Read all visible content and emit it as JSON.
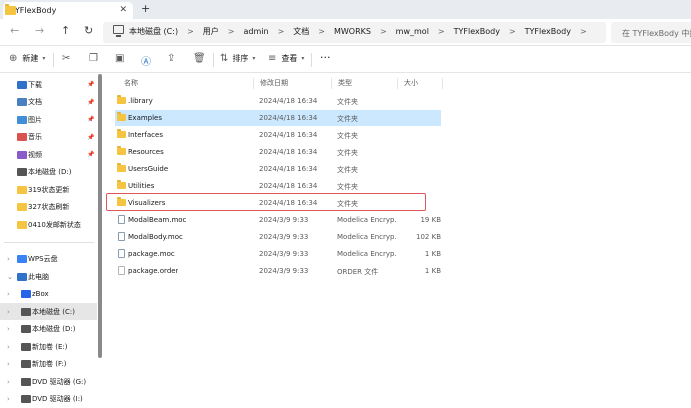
{
  "window": {
    "tab_title": "TYFlexBody",
    "tab_close": "✕",
    "tab_add": "+"
  },
  "nav": {
    "back": "←",
    "forward": "→",
    "up": "↑",
    "refresh": "↻"
  },
  "address": {
    "crumbs": [
      "本地磁盘 (C:)",
      "用户",
      "admin",
      "文档",
      "MWORKS",
      "mw_mol",
      "TYFlexBody",
      "TYFlexBody"
    ],
    "separator": ">",
    "search_placeholder": "在 TYFlexBody 中搜索"
  },
  "toolbar": {
    "new_label": "新建",
    "sort_label": "排序",
    "view_label": "查看",
    "more_label": "···"
  },
  "sidebar": {
    "pinned": [
      {
        "label": "下载",
        "icon": "download-icon",
        "color": "#2f72c9"
      },
      {
        "label": "文档",
        "icon": "document-icon",
        "color": "#4a7fc1"
      },
      {
        "label": "图片",
        "icon": "picture-icon",
        "color": "#3f8fd6"
      },
      {
        "label": "音乐",
        "icon": "music-icon",
        "color": "#d9534f"
      },
      {
        "label": "视频",
        "icon": "video-icon",
        "color": "#8a5cc7"
      },
      {
        "label": "本地磁盘 (D:)",
        "icon": "drive-icon",
        "color": "#555555"
      },
      {
        "label": "319状态更新",
        "icon": "folder-icon",
        "color": "#f5c542"
      },
      {
        "label": "327状态刷新",
        "icon": "folder-icon",
        "color": "#f5c542"
      },
      {
        "label": "0410发邮新状态",
        "icon": "folder-icon",
        "color": "#f5c542"
      }
    ],
    "tree": [
      {
        "label": "WPS云盘",
        "icon": "cloud-icon",
        "color": "#3b82f6"
      },
      {
        "label": "此电脑",
        "icon": "pc-icon",
        "color": "#2f72c9"
      },
      {
        "label": "zBox",
        "icon": "zbox-icon",
        "color": "#2563eb"
      },
      {
        "label": "本地磁盘 (C:)",
        "icon": "drive-icon",
        "color": "#555555"
      },
      {
        "label": "本地磁盘 (D:)",
        "icon": "drive-icon",
        "color": "#555555"
      },
      {
        "label": "新加卷 (E:)",
        "icon": "drive-icon",
        "color": "#555555"
      },
      {
        "label": "新加卷 (F:)",
        "icon": "drive-icon",
        "color": "#555555"
      },
      {
        "label": "DVD 驱动器 (G:)",
        "icon": "dvd-icon",
        "color": "#555555"
      },
      {
        "label": "DVD 驱动器 (I:)",
        "icon": "dvd-icon",
        "color": "#555555"
      }
    ]
  },
  "columns": {
    "name": "名称",
    "date": "修改日期",
    "type": "类型",
    "size": "大小"
  },
  "files": [
    {
      "name": ".library",
      "date": "2024/4/18 16:34",
      "type": "文件夹",
      "size": "",
      "kind": "folder"
    },
    {
      "name": "Examples",
      "date": "2024/4/18 16:34",
      "type": "文件夹",
      "size": "",
      "kind": "folder"
    },
    {
      "name": "Interfaces",
      "date": "2024/4/18 16:34",
      "type": "文件夹",
      "size": "",
      "kind": "folder"
    },
    {
      "name": "Resources",
      "date": "2024/4/18 16:34",
      "type": "文件夹",
      "size": "",
      "kind": "folder"
    },
    {
      "name": "UsersGuide",
      "date": "2024/4/18 16:34",
      "type": "文件夹",
      "size": "",
      "kind": "folder"
    },
    {
      "name": "Utilities",
      "date": "2024/4/18 16:34",
      "type": "文件夹",
      "size": "",
      "kind": "folder"
    },
    {
      "name": "Visualizers",
      "date": "2024/4/18 16:34",
      "type": "文件夹",
      "size": "",
      "kind": "folder"
    },
    {
      "name": "ModalBeam.moc",
      "date": "2024/3/9 9:33",
      "type": "Modelica Encryp...",
      "size": "19 KB",
      "kind": "moc"
    },
    {
      "name": "ModalBody.moc",
      "date": "2024/3/9 9:33",
      "type": "Modelica Encryp...",
      "size": "102 KB",
      "kind": "moc"
    },
    {
      "name": "package.moc",
      "date": "2024/3/9 9:33",
      "type": "Modelica Encryp...",
      "size": "1 KB",
      "kind": "moc"
    },
    {
      "name": "package.order",
      "date": "2024/3/9 9:33",
      "type": "ORDER 文件",
      "size": "1 KB",
      "kind": "plain"
    }
  ],
  "selected_index": 1,
  "highlighted_index": 6,
  "colors": {
    "selection": "#cce8ff",
    "highlight_box": "#e0575b",
    "folder": "#f5c542"
  }
}
